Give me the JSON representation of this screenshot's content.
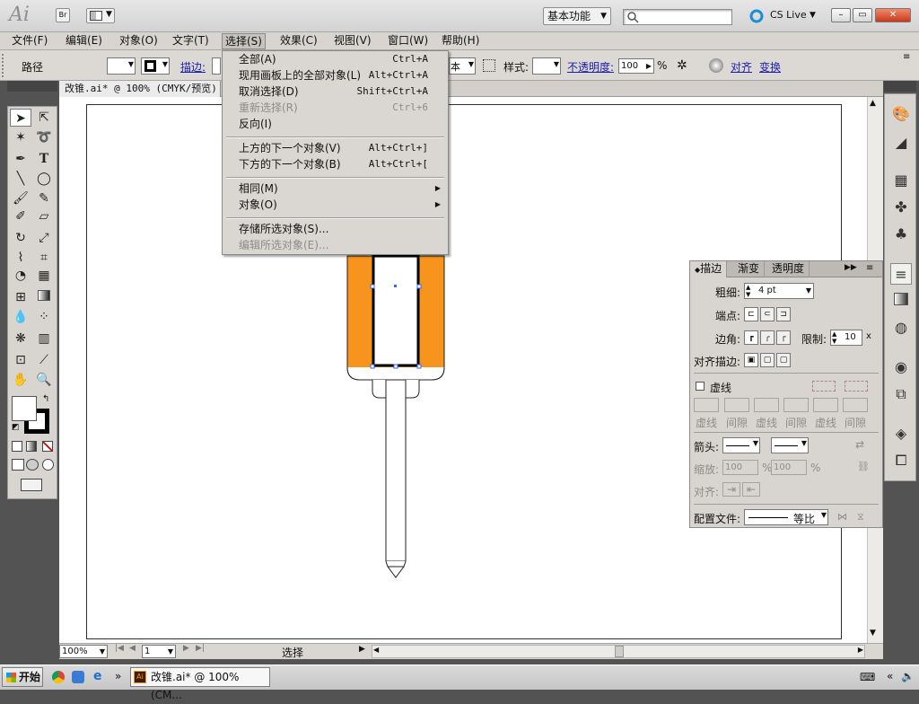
{
  "titlebar": {
    "app_logo": "Ai",
    "bridge_label": "Br",
    "workspace": "基本功能",
    "cs_live": "CS Live",
    "minimize": "–",
    "restore": "▭",
    "close": "✕"
  },
  "menubar": [
    "文件(F)",
    "编辑(E)",
    "对象(O)",
    "文字(T)",
    "选择(S)",
    "效果(C)",
    "视图(V)",
    "窗口(W)",
    "帮助(H)"
  ],
  "control": {
    "object_type": "路径",
    "stroke_label": "描边:",
    "profile_partial": "本",
    "style_label": "样式:",
    "opacity_label": "不透明度:",
    "opacity_value": "100",
    "opacity_unit": "%",
    "align_label": "对齐",
    "transform_label": "变换"
  },
  "document": {
    "tab_title": "改锥.ai* @ 100% (CMYK/预览)"
  },
  "select_menu": {
    "all": {
      "label": "全部(A)",
      "shortcut": "Ctrl+A"
    },
    "all_on_artboard": {
      "label": "现用画板上的全部对象(L)",
      "shortcut": "Alt+Ctrl+A"
    },
    "deselect": {
      "label": "取消选择(D)",
      "shortcut": "Shift+Ctrl+A"
    },
    "reselect": {
      "label": "重新选择(R)",
      "shortcut": "Ctrl+6"
    },
    "inverse": {
      "label": "反向(I)"
    },
    "next_above": {
      "label": "上方的下一个对象(V)",
      "shortcut": "Alt+Ctrl+]"
    },
    "next_below": {
      "label": "下方的下一个对象(B)",
      "shortcut": "Alt+Ctrl+["
    },
    "same": {
      "label": "相同(M)"
    },
    "object": {
      "label": "对象(O)"
    },
    "save_selection": {
      "label": "存储所选对象(S)..."
    },
    "edit_selection": {
      "label": "编辑所选对象(E)..."
    }
  },
  "stroke_panel": {
    "tabs": [
      "描边",
      "渐变",
      "透明度"
    ],
    "weight_label": "粗细:",
    "weight_value": "4 pt",
    "cap_label": "端点:",
    "corner_label": "边角:",
    "limit_label": "限制:",
    "limit_value": "10",
    "limit_unit": "x",
    "align_stroke_label": "对齐描边:",
    "dashed_label": "虚线",
    "dash_labels": [
      "虚线",
      "间隙",
      "虚线",
      "间隙",
      "虚线",
      "间隙"
    ],
    "arrow_label": "箭头:",
    "scale_label": "缩放:",
    "scale_value_1": "100",
    "scale_value_2": "100",
    "scale_unit": "%",
    "align_label": "对齐:",
    "profile_label": "配置文件:",
    "profile_value": "等比"
  },
  "statusbar": {
    "zoom": "100%",
    "artboard_num": "1",
    "tool_status": "选择"
  },
  "taskbar": {
    "start": "开始",
    "quick_more": "»",
    "task_ai": "改锥.ai* @ 100% (CM..."
  },
  "colors": {
    "orange_handle": "#F7941D",
    "selection_blue": "#3366ff"
  }
}
